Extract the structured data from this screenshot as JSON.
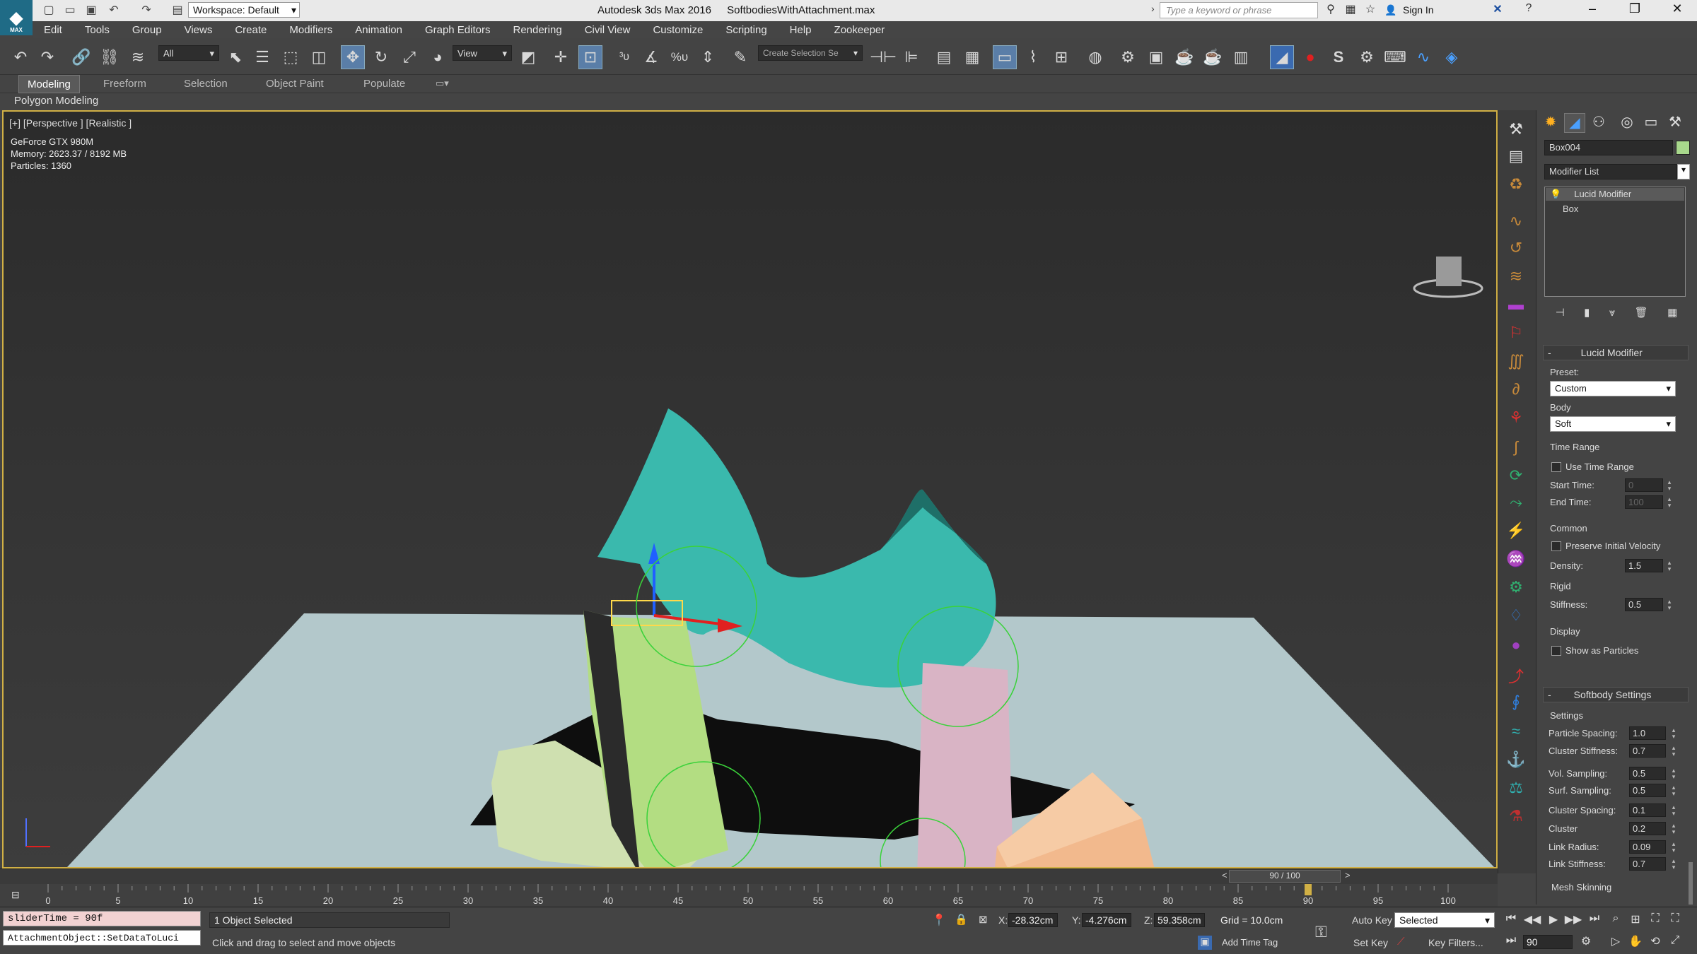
{
  "title_bar": {
    "app": "Autodesk 3ds Max 2016",
    "file": "SoftbodiesWithAttachment.max",
    "workspace": "Workspace: Default",
    "search_placeholder": "Type a keyword or phrase",
    "sign_in": "Sign In",
    "logo": "MAX"
  },
  "menu": [
    "Edit",
    "Tools",
    "Group",
    "Views",
    "Create",
    "Modifiers",
    "Animation",
    "Graph Editors",
    "Rendering",
    "Civil View",
    "Customize",
    "Scripting",
    "Help",
    "Zookeeper"
  ],
  "toolbar": {
    "selection_filter": "All",
    "ref_coord": "View",
    "named_selection_placeholder": "Create Selection Se",
    "icons": [
      "undo-icon",
      "redo-icon",
      "link-icon",
      "unlink-icon",
      "bind-spacewarp-icon",
      "select-icon",
      "select-by-name-icon",
      "rect-region-icon",
      "window-crossing-icon",
      "select-move-icon",
      "select-rotate-icon",
      "select-scale-icon",
      "place-icon",
      "mirror-icon",
      "align-icon",
      "layer-icon",
      "curve-editor-icon",
      "schematic-icon",
      "material-editor-icon",
      "render-setup-icon",
      "render-icon"
    ]
  },
  "ribbon": {
    "tabs": [
      "Modeling",
      "Freeform",
      "Selection",
      "Object Paint",
      "Populate"
    ],
    "active": "Modeling",
    "subpanel": "Polygon Modeling"
  },
  "viewport": {
    "label": "[+] [Perspective ] [Realistic ]",
    "stats": [
      "GeForce GTX 980M",
      "Memory: 2623.37 / 8192 MB",
      "Particles: 1360"
    ]
  },
  "command_panel": {
    "object_name": "Box004",
    "object_color": "#a8d88c",
    "modifier_list": "Modifier List",
    "stack": [
      "Lucid Modifier",
      "Box"
    ],
    "rollout_lucid": {
      "title": "Lucid Modifier",
      "preset_label": "Preset:",
      "preset": "Custom",
      "body_label": "Body",
      "body": "Soft",
      "time_range": "Time Range",
      "use_time_range": "Use Time Range",
      "start_time_label": "Start Time:",
      "start_time": "0",
      "end_time_label": "End Time:",
      "end_time": "100",
      "common": "Common",
      "preserve_velocity": "Preserve Initial Velocity",
      "density_label": "Density:",
      "density": "1.5",
      "rigid": "Rigid",
      "stiffness_label": "Stiffness:",
      "stiffness": "0.5",
      "display": "Display",
      "show_particles": "Show as Particles"
    },
    "rollout_softbody": {
      "title": "Softbody Settings",
      "settings": "Settings",
      "params": [
        {
          "label": "Particle Spacing:",
          "value": "1.0"
        },
        {
          "label": "Cluster Stiffness:",
          "value": "0.7"
        },
        {
          "label": "Vol. Sampling:",
          "value": "0.5"
        },
        {
          "label": "Surf. Sampling:",
          "value": "0.5"
        },
        {
          "label": "Cluster Spacing:",
          "value": "0.1"
        },
        {
          "label": "Cluster",
          "value": "0.2"
        },
        {
          "label": "Link Radius:",
          "value": "0.09"
        },
        {
          "label": "Link Stiffness:",
          "value": "0.7"
        }
      ],
      "mesh_skinning": "Mesh Skinning"
    }
  },
  "timeline": {
    "slider_label": "90 / 100",
    "current_frame": 90,
    "total_frames": 100,
    "ticks": [
      "0",
      "5",
      "10",
      "15",
      "20",
      "25",
      "30",
      "35",
      "40",
      "45",
      "50",
      "55",
      "60",
      "65",
      "70",
      "75",
      "80",
      "85",
      "90",
      "95",
      "100"
    ]
  },
  "status": {
    "listener_line1": "sliderTime = 90f",
    "listener_line2": "AttachmentObject::SetDataToLuci",
    "selected": "1 Object Selected",
    "prompt": "Click and drag to select and move objects",
    "x": "-28.32cm",
    "y": "-4.276cm",
    "z": "59.358cm",
    "grid": "Grid = 10.0cm",
    "add_time_tag": "Add Time Tag",
    "auto_key": "Auto Key",
    "set_key": "Set Key",
    "selected_combo": "Selected",
    "key_filters": "Key Filters...",
    "frame": "90"
  }
}
